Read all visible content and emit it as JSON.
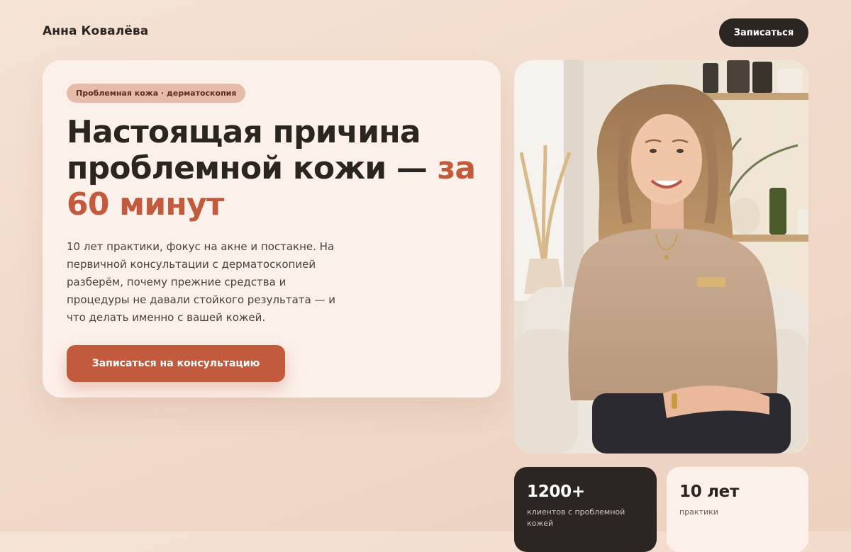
{
  "header": {
    "brand_name": "Анна Ковалёва",
    "cta_label": "Записаться"
  },
  "hero": {
    "tag": "Проблемная кожа · дерматоскопия",
    "headline_main": "Настоящая причина проблемной кожи —",
    "headline_accent": "за 60 минут",
    "lead": "10 лет практики, фокус на акне и постакне. На первичной консультации с дерматоскопией разберём, почему прежние средства и процедуры не давали стойкого результата — и что делать именно с вашей кожей.",
    "cta_label": "Записаться на консультацию"
  },
  "photo": {
    "icon": "specialist-portrait"
  },
  "stats": [
    {
      "value": "1200+",
      "label": "клиентов с проблемной кожей"
    },
    {
      "value": "10 лет",
      "label": "практики"
    }
  ],
  "colors": {
    "accent": "#c25a3e",
    "dark": "#2c2623",
    "card": "#fcf1ea",
    "tag": "#e6bca8"
  }
}
